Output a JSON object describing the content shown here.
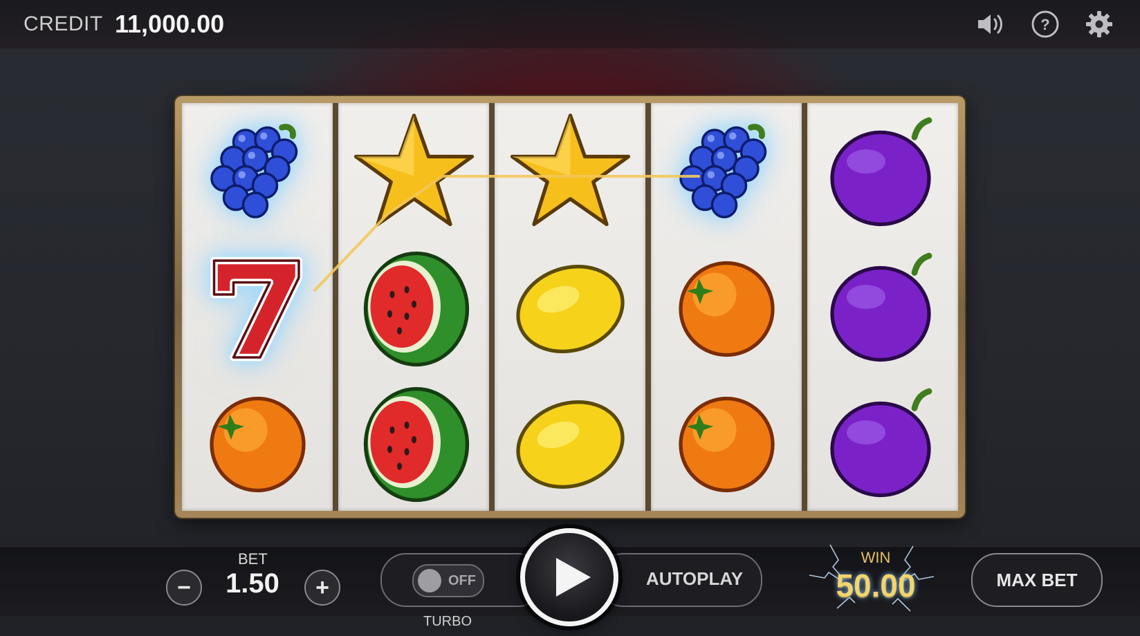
{
  "header": {
    "credit_label": "CREDIT",
    "credit_value": "11,000.00",
    "icons": [
      "sound-icon",
      "help-icon",
      "settings-icon"
    ]
  },
  "reels": [
    [
      "grapes",
      "seven",
      "orange"
    ],
    [
      "star",
      "watermelon",
      "watermelon"
    ],
    [
      "star",
      "lemon",
      "lemon"
    ],
    [
      "grapes",
      "orange",
      "orange"
    ],
    [
      "plum",
      "plum",
      "plum"
    ]
  ],
  "winning_symbols": [
    "reel1-row1",
    "reel1-row2",
    "reel4-row1"
  ],
  "controls": {
    "bet_label": "BET",
    "bet_value": "1.50",
    "bet_decrease": "−",
    "bet_increase": "+",
    "turbo_state": "OFF",
    "turbo_label": "TURBO",
    "autoplay_label": "AUTOPLAY",
    "win_label": "WIN",
    "win_value": "50.00",
    "max_bet_label": "MAX BET"
  },
  "colors": {
    "accent_gold": "#f3d46c",
    "background_red": "#96101a",
    "reel_background": "#ecebe8"
  }
}
